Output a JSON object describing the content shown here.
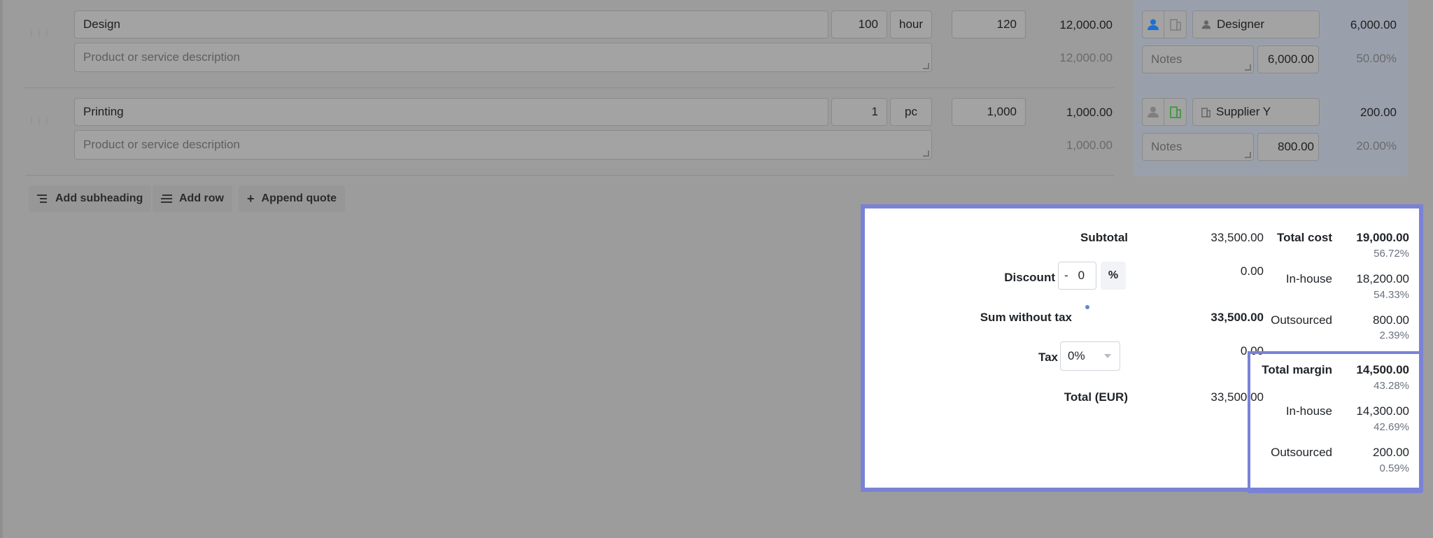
{
  "rows": [
    {
      "name": "Design",
      "quantity": "100",
      "unit": "hour",
      "price": "120",
      "total": "12,000.00",
      "total_sub": "12,000.00",
      "description_placeholder": "Product or service description",
      "assignee": "Designer",
      "cost": "6,000.00",
      "notes_placeholder": "Notes",
      "margin_value": "6,000.00",
      "margin_pct": "50.00%",
      "active_type": "person"
    },
    {
      "name": "Printing",
      "quantity": "1",
      "unit": "pc",
      "price": "1,000",
      "total": "1,000.00",
      "total_sub": "1,000.00",
      "description_placeholder": "Product or service description",
      "assignee": "Supplier Y",
      "cost": "200.00",
      "notes_placeholder": "Notes",
      "margin_value": "800.00",
      "margin_pct": "20.00%",
      "active_type": "supplier"
    }
  ],
  "actions": {
    "add_subheading": "Add subheading",
    "add_row": "Add row",
    "append_quote": "Append quote"
  },
  "summary": {
    "subtotal_label": "Subtotal",
    "subtotal": "33,500.00",
    "discount_label": "Discount",
    "discount_minus": "-",
    "discount_value": "0",
    "discount_unit": "%",
    "discount_amount": "0.00",
    "sum_without_tax_label": "Sum without tax",
    "sum_without_tax": "33,500.00",
    "tax_label": "Tax",
    "tax_value": "0%",
    "tax_amount": "0.00",
    "total_label": "Total (EUR)",
    "total": "33,500.00"
  },
  "costs": {
    "total_cost_label": "Total cost",
    "total_cost": "19,000.00",
    "total_cost_pct": "56.72%",
    "inhouse_label": "In-house",
    "inhouse": "18,200.00",
    "inhouse_pct": "54.33%",
    "outsourced_label": "Outsourced",
    "outsourced": "800.00",
    "outsourced_pct": "2.39%"
  },
  "margins": {
    "total_margin_label": "Total margin",
    "total_margin": "14,500.00",
    "total_margin_pct": "43.28%",
    "inhouse_label": "In-house",
    "inhouse": "14,300.00",
    "inhouse_pct": "42.69%",
    "outsourced_label": "Outsourced",
    "outsourced": "200.00",
    "outsourced_pct": "0.59%"
  },
  "colors": {
    "highlight": "#7a82d6",
    "person_active": "#1d6fd0",
    "supplier_active": "#3d9a3d"
  }
}
